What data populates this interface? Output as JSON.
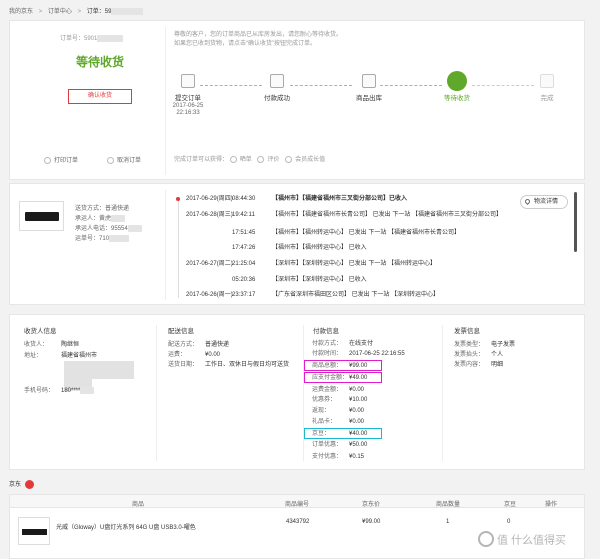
{
  "breadcrumb": {
    "home": "我的京东",
    "sep": ">",
    "center": "订单中心",
    "order": "订单：59"
  },
  "summary": {
    "order_no_label": "订单号：5901",
    "status": "等待收货",
    "confirm_btn": "确认收货",
    "print": "打印订单",
    "cancel": "取消订单",
    "notice_line1": "尊敬的客户，您的订单商品已从库房发出，请您耐心等待收货。",
    "notice_line2": "如果您已收到货物，请点击“确认收货”按钮完成订单。",
    "steps": [
      {
        "label": "提交订单",
        "time1": "2017-06-25",
        "time2": "22:16:33"
      },
      {
        "label": "付款成功",
        "time1": "",
        "time2": ""
      },
      {
        "label": "商品出库",
        "time1": "",
        "time2": ""
      },
      {
        "label": "等待收货",
        "time1": "",
        "time2": ""
      },
      {
        "label": "完成",
        "time1": "",
        "time2": ""
      }
    ],
    "after_label": "完成订单可以获得：",
    "after_items": [
      "晒单",
      "评价",
      "会员成长值"
    ]
  },
  "logistics": {
    "method_label": "送货方式：",
    "method_value": "普通快递",
    "carrier_label": "承运人：",
    "carrier_value": "黄虎",
    "phone_label": "承运人电话：",
    "phone_value": "95554",
    "waybill_label": "运单号：",
    "waybill_value": "710",
    "track_btn": "物流详情",
    "events": [
      {
        "date": "2017-06-29(周四)",
        "time": "08:44:30",
        "text": "【福州市】【福建省福州市三叉街分部公司】已收入",
        "latest": true
      },
      {
        "date": "2017-06-28(周三)",
        "time": "19:42:11",
        "text": "【福州市】【福建省福州市长青公司】 已发出 下一站 【福建省福州市三叉街分部公司】",
        "latest": false
      },
      {
        "date": "",
        "time": "17:51:45",
        "text": "【福州市】【福州转运中心】 已发出 下一站 【福建省福州市长青公司】",
        "latest": false
      },
      {
        "date": "",
        "time": "17:47:26",
        "text": "【福州市】【福州转运中心】 已收入",
        "latest": false
      },
      {
        "date": "2017-06-27(周二)",
        "time": "21:25:04",
        "text": "【深圳市】【深圳转运中心】 已发出 下一站 【福州转运中心】",
        "latest": false
      },
      {
        "date": "",
        "time": "05:20:36",
        "text": "【深圳市】【深圳转运中心】 已收入",
        "latest": false
      },
      {
        "date": "2017-06-26(周一)",
        "time": "23:37:17",
        "text": "【广东省深圳市福田区公司】 已发出 下一站 【深圳转运中心】",
        "latest": false
      }
    ]
  },
  "info": {
    "receiver": {
      "title": "收货人信息",
      "name_label": "收货人：",
      "name_value": "陶继恒",
      "addr_label": "地址：",
      "addr_value": "福建省福州市",
      "phone_label": "手机号码：",
      "phone_value": "180****"
    },
    "delivery": {
      "title": "配送信息",
      "method_label": "配送方式：",
      "method_value": "普通快递",
      "fee_label": "运费：",
      "fee_value": "¥0.00",
      "date_label": "送货日期：",
      "date_value": "工作日、双休日与假日均可送货"
    },
    "payment": {
      "title": "付款信息",
      "rows": [
        {
          "k": "付款方式：",
          "v": "在线支付"
        },
        {
          "k": "付款时间：",
          "v": "2017-06-25 22:16:55"
        },
        {
          "k": "商品总额：",
          "v": "¥99.00"
        },
        {
          "k": "应支付金额：",
          "v": "¥49.00"
        },
        {
          "k": "运费金额：",
          "v": "¥0.00"
        },
        {
          "k": "优惠券：",
          "v": "¥10.00"
        },
        {
          "k": "返现：",
          "v": "¥0.00"
        },
        {
          "k": "礼品卡：",
          "v": "¥0.00"
        },
        {
          "k": "京豆：",
          "v": "¥40.00"
        },
        {
          "k": "订单优惠：",
          "v": "¥50.00"
        },
        {
          "k": "支付优惠：",
          "v": "¥0.15"
        }
      ]
    },
    "invoice": {
      "title": "发票信息",
      "type_label": "发票类型：",
      "type_value": "电子发票",
      "head_label": "发票抬头：",
      "head_value": "个人",
      "content_label": "发票内容：",
      "content_value": "明细"
    }
  },
  "shop": {
    "name": "京东"
  },
  "table": {
    "headers": [
      "商品",
      "商品编号",
      "京东价",
      "商品数量",
      "京豆",
      "操作"
    ],
    "rows": [
      {
        "name": "光威（Gloway）U盘灯光系列 64G U盘 USB3.0-曜色",
        "sku": "4343792",
        "price": "¥99.00",
        "qty": "1",
        "beans": "0",
        "op": ""
      }
    ]
  },
  "watermark": "值 什么值得买",
  "colors": {
    "green": "#5fa82a",
    "red": "#e4393c",
    "magenta": "#e21bcf",
    "teal": "#19b9d4"
  }
}
